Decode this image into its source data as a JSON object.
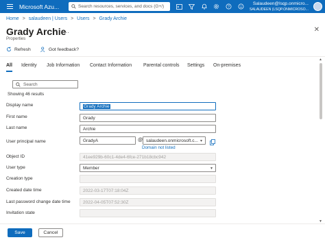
{
  "topbar": {
    "brand": "Microsoft Azu...",
    "search_placeholder": "Search resources, services, and docs (G+/)",
    "user_name": "Salaudeen@lsqp.onmicro...",
    "user_tenant": "SALAUDEEN (LSQP.ONMICROSO..."
  },
  "breadcrumb": [
    "Home",
    "salaudeen | Users",
    "Users",
    "Grady Archie"
  ],
  "page": {
    "title": "Grady Archie",
    "more": "···",
    "subtitle": "Properties",
    "close": "✕"
  },
  "commands": {
    "refresh": "Refresh",
    "feedback": "Got feedback?"
  },
  "tabs": [
    "All",
    "Identity",
    "Job Information",
    "Contact Information",
    "Parental controls",
    "Settings",
    "On-premises"
  ],
  "filter": {
    "placeholder": "Search",
    "count": "Showing 46 results"
  },
  "fields": {
    "display_name": {
      "label": "Display name",
      "value": "Grady Archie"
    },
    "first_name": {
      "label": "First name",
      "value": "Grady"
    },
    "last_name": {
      "label": "Last name",
      "value": "Archie"
    },
    "upn": {
      "label": "User principal name",
      "value": "GradyA",
      "at": "@",
      "domain": "salaudeen.onmicrosoft.c...",
      "domain_help": "Domain not listed"
    },
    "object_id": {
      "label": "Object ID",
      "value": "41ee929b-60c1-4de4-6fce-271b18cbc942"
    },
    "user_type": {
      "label": "User type",
      "value": "Member"
    },
    "creation_type": {
      "label": "Creation type",
      "value": ""
    },
    "created": {
      "label": "Created date time",
      "value": "2022-03-17T07:18:04Z"
    },
    "last_pwd": {
      "label": "Last password change date time",
      "value": "2022-04-05T07:52:30Z"
    },
    "invitation": {
      "label": "Invitation state",
      "value": ""
    }
  },
  "footer": {
    "save": "Save",
    "cancel": "Cancel"
  },
  "colors": {
    "accent": "#0f6cbd",
    "topbar": "#0f6cbd"
  }
}
